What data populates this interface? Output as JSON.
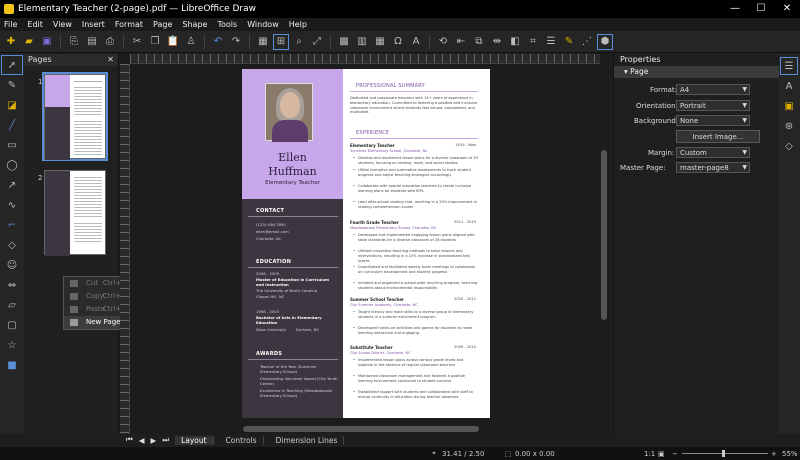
{
  "window": {
    "title": "Elementary Teacher (2-page).pdf — LibreOffice Draw",
    "minimize": "—",
    "maximize": "☐",
    "close": "✕"
  },
  "menubar": [
    "File",
    "Edit",
    "View",
    "Insert",
    "Format",
    "Page",
    "Shape",
    "Tools",
    "Window",
    "Help"
  ],
  "pages_pane": {
    "title": "Pages",
    "close": "✕",
    "thumb1_num": "1",
    "thumb2_num": "2"
  },
  "context_menu": {
    "cut": "Cut",
    "cut_shortcut": "Ctrl+X",
    "copy": "Copy",
    "copy_shortcut": "Ctrl+C",
    "paste": "Paste",
    "paste_shortcut": "Ctrl+V",
    "new_page": "New Page"
  },
  "resume": {
    "first_name": "Ellen",
    "last_name": "Huffman",
    "role": "Elementary Teacher",
    "contact": {
      "heading": "CONTACT",
      "phone": "(123) 456-7890",
      "email": "ellen@email.com",
      "city": "Charlotte, NC"
    },
    "education": {
      "heading": "EDUCATION",
      "items": [
        {
          "years": "2006 - 2009",
          "degree": "Master of Education in Curriculum and Instruction",
          "school": "The University of North Carolina",
          "place": "Chapel Hill, NC"
        },
        {
          "years": "1998 - 2003",
          "degree": "Bachelor of Arts in Elementary Education",
          "school": "Duke University",
          "place": "Durham, NC"
        }
      ]
    },
    "awards": {
      "heading": "AWARDS",
      "items": [
        "Teacher of the Year (Sunshine Elementary School)",
        "Outstanding Volunteer Award (City Youth Center)",
        "Excellence in Teaching (Meadowbrook Elementary School)"
      ]
    },
    "summary": {
      "heading": "PROFESSIONAL SUMMARY",
      "text": "Dedicated and passionate educator with 14+ years of experience in elementary education. Committed to fostering a positive and inclusive classroom environment where students feel valued, empowered, and motivated."
    },
    "experience": {
      "heading": "EXPERIENCE",
      "jobs": [
        {
          "title": "Elementary Teacher",
          "dates": "2019 - Now",
          "org": "Sunshine Elementary School, Charlotte, NC",
          "bullets": [
            "Develop and implement lesson plans for a diverse classroom of 25 students, focusing on reading, math, and social studies",
            "Utilize formative and summative assessments to track student progress and adjust teaching strategies accordingly",
            "Collaborate with special education teachers to create inclusive learning plans for students with IEPs",
            "Lead after-school reading club, resulting in a 20% improvement in reading comprehension scores"
          ]
        },
        {
          "title": "Fourth Grade Teacher",
          "dates": "2011 - 2019",
          "org": "Meadowbrook Elementary School, Charlotte, NC",
          "bullets": [
            "Developed and implemented engaging lesson plans aligned with state standards for a diverse classroom of 28 students",
            "Utilized innovative teaching methods to tailor lessons and interventions, resulting in a 15% increase in standardized test scores",
            "Coordinated and facilitated weekly team meetings to collaborate on curriculum development and student progress",
            "Initiated and organized a school-wide recycling program, teaching students about environmental responsibility"
          ]
        },
        {
          "title": "Summer School Teacher",
          "dates": "2010 - 2011",
          "org": "City Summer Academy, Charlotte, NC",
          "bullets": [
            "Taught literacy and math skills to a diverse group of elementary students in a summer enrichment program",
            "Developed hands-on activities and games for students to make learning interactive and engaging"
          ]
        },
        {
          "title": "Substitute Teacher",
          "dates": "2009 - 2010",
          "org": "City School District, Charlotte, NC",
          "bullets": [
            "Implemented lesson plans across various grade levels and subjects in the absence of regular classroom teachers",
            "Maintained classroom management and fostered a positive learning environment conducive to student success",
            "Established rapport with students and collaborated with staff to ensure continuity in education during teacher absences"
          ]
        }
      ]
    }
  },
  "properties": {
    "title": "Properties",
    "section": "Page",
    "format_label": "Format:",
    "format_value": "A4",
    "orientation_label": "Orientation:",
    "orientation_value": "Portrait",
    "background_label": "Background:",
    "background_value": "None",
    "insert_image": "Insert Image...",
    "margin_label": "Margin:",
    "margin_value": "Custom",
    "master_label": "Master Page:",
    "master_value": "master-page8"
  },
  "tabs": [
    "Layout",
    "Controls",
    "Dimension Lines"
  ],
  "status": {
    "coords": "31.41 / 2.50",
    "size": "0.00 x 0.00",
    "scale": "1:1",
    "zoom": "55%"
  },
  "colors": {
    "accent": "#c8a6ea",
    "sidebar": "#3b3640",
    "heading": "#7b4fa5"
  }
}
